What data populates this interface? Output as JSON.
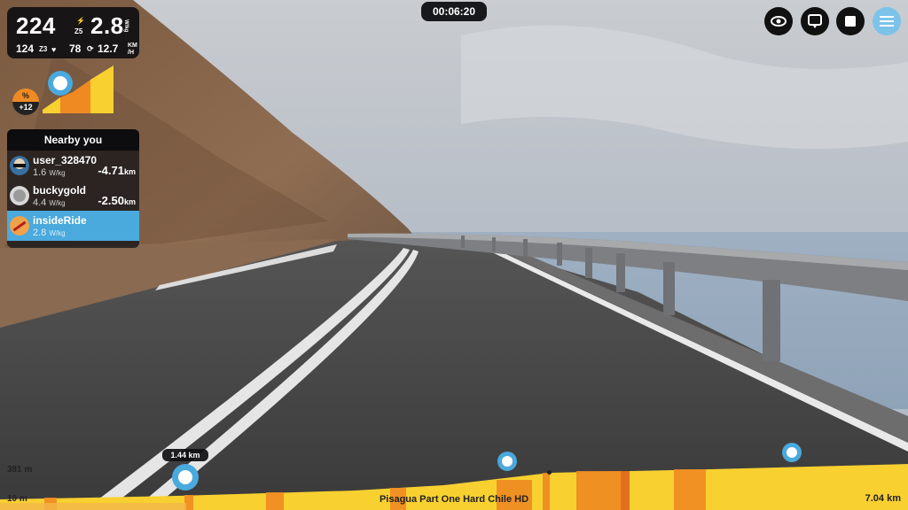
{
  "metrics": {
    "power": "224",
    "power_zone": "Z5",
    "wkg": "2.8",
    "wkg_unit": "W/kg",
    "hr": "124",
    "hr_zone": "Z3",
    "cadence": "78",
    "speed": "12.7",
    "speed_unit_top": "KM",
    "speed_unit_bottom": "/H"
  },
  "grade": {
    "symbol": "%",
    "value": "+12"
  },
  "timer": "00:06:20",
  "controls": [
    "eye-icon",
    "screen-share-icon",
    "stop-icon",
    "menu-icon"
  ],
  "nearby": {
    "title": "Nearby you",
    "riders": [
      {
        "name": "user_328470",
        "wkg": "1.6",
        "unit": "W/kg",
        "distance": "-4.71",
        "dist_unit": "km"
      },
      {
        "name": "buckygold",
        "wkg": "4.4",
        "unit": "W/kg",
        "distance": "-2.50",
        "dist_unit": "km"
      },
      {
        "name": "insideRide",
        "wkg": "2.8",
        "unit": "W/kg",
        "distance": "",
        "dist_unit": ""
      }
    ]
  },
  "course": {
    "title": "Pisagua Part One Hard Chile HD",
    "max_elevation": "381 m",
    "min_elevation": "10 m",
    "total_distance": "7.04 km",
    "marker_distance": "1.44 km"
  },
  "colors": {
    "accent_blue": "#4aa9dd",
    "elevation_yellow": "#f8d030",
    "elevation_orange": "#ef8a22",
    "hud_dark": "#111114"
  }
}
